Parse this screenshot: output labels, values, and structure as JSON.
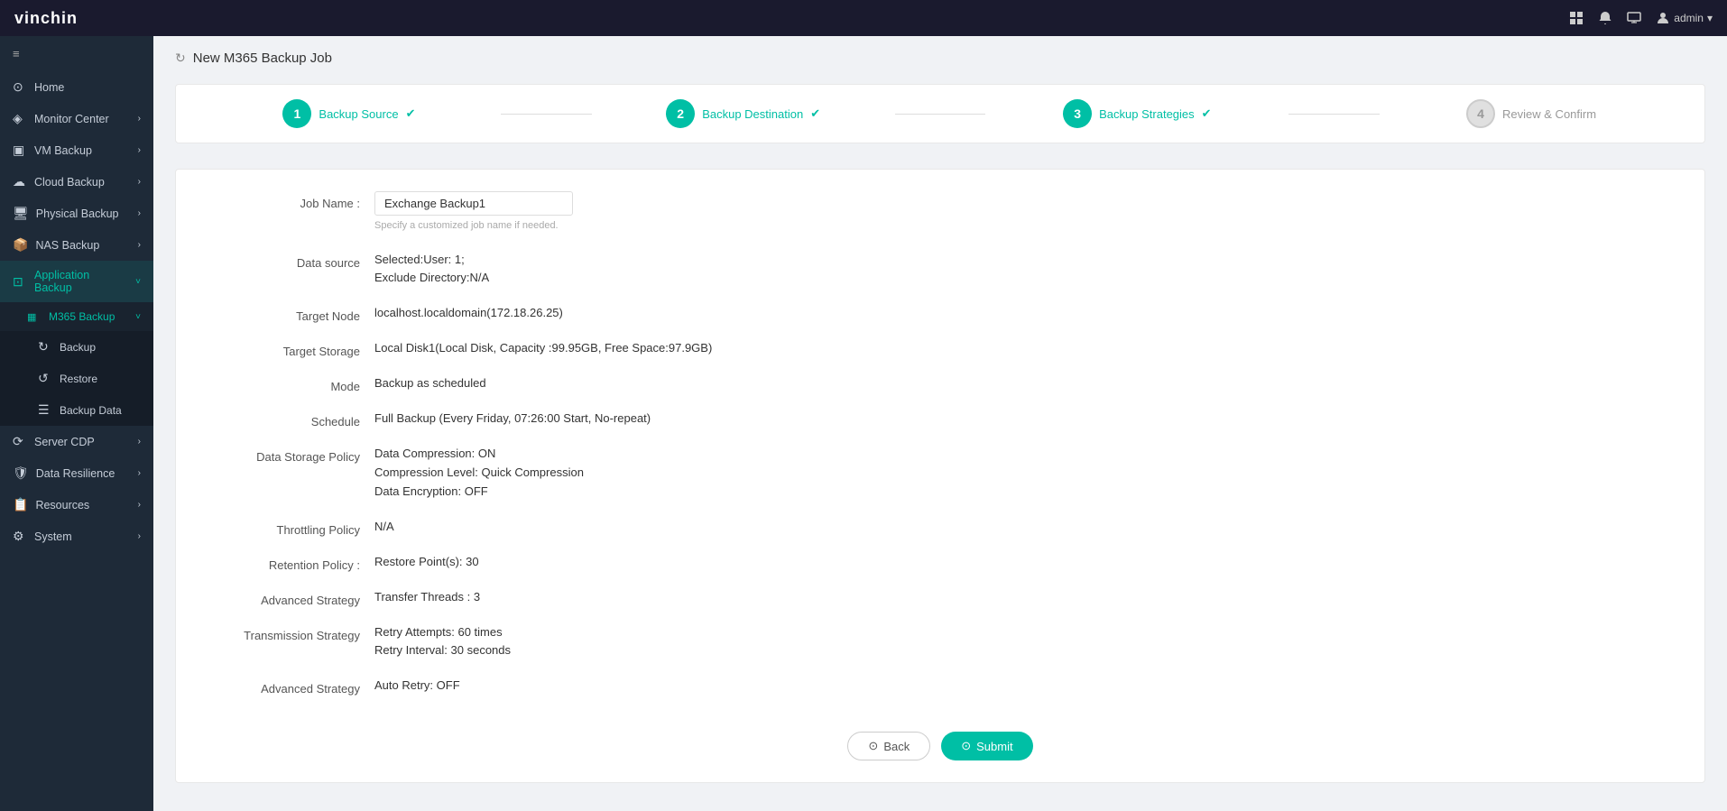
{
  "topbar": {
    "logo_vin": "vin",
    "logo_chin": "chin",
    "icons": [
      "grid-icon",
      "bell-icon",
      "monitor-icon",
      "user-icon"
    ],
    "user_label": "admin"
  },
  "sidebar": {
    "toggle_icon": "≡",
    "items": [
      {
        "id": "home",
        "label": "Home",
        "icon": "⊙",
        "expandable": false
      },
      {
        "id": "monitor-center",
        "label": "Monitor Center",
        "icon": "◈",
        "expandable": true
      },
      {
        "id": "vm-backup",
        "label": "VM Backup",
        "icon": "▣",
        "expandable": true
      },
      {
        "id": "cloud-backup",
        "label": "Cloud Backup",
        "icon": "☁",
        "expandable": true
      },
      {
        "id": "physical-backup",
        "label": "Physical Backup",
        "icon": "🖥",
        "expandable": true
      },
      {
        "id": "nas-backup",
        "label": "NAS Backup",
        "icon": "📦",
        "expandable": true
      },
      {
        "id": "application-backup",
        "label": "Application Backup",
        "icon": "⊡",
        "expandable": true,
        "active": true,
        "children": [
          {
            "id": "m365-backup",
            "label": "M365 Backup",
            "expandable": true,
            "active": true,
            "children": [
              {
                "id": "backup",
                "label": "Backup"
              },
              {
                "id": "restore",
                "label": "Restore"
              },
              {
                "id": "backup-data",
                "label": "Backup Data"
              }
            ]
          }
        ]
      },
      {
        "id": "server-cdp",
        "label": "Server CDP",
        "icon": "⟳",
        "expandable": true
      },
      {
        "id": "data-resilience",
        "label": "Data Resilience",
        "icon": "🛡",
        "expandable": true
      },
      {
        "id": "resources",
        "label": "Resources",
        "icon": "📋",
        "expandable": true
      },
      {
        "id": "system",
        "label": "System",
        "icon": "⚙",
        "expandable": true
      }
    ]
  },
  "page": {
    "refresh_icon": "↻",
    "title": "New M365 Backup Job",
    "steps": [
      {
        "number": "1",
        "label": "Backup Source",
        "status": "done"
      },
      {
        "number": "2",
        "label": "Backup Destination",
        "status": "done"
      },
      {
        "number": "3",
        "label": "Backup Strategies",
        "status": "done"
      },
      {
        "number": "4",
        "label": "Review & Confirm",
        "status": "inactive"
      }
    ],
    "form": {
      "job_name_label": "Job Name :",
      "job_name_value": "Exchange Backup1",
      "job_name_hint": "Specify a customized job name if needed.",
      "data_source_label": "Data source",
      "data_source_value": "Selected:User: 1;\nExclude Directory:N/A",
      "target_node_label": "Target Node",
      "target_node_value": "localhost.localdomain(172.18.26.25)",
      "target_storage_label": "Target Storage",
      "target_storage_value": "Local Disk1(Local Disk, Capacity :99.95GB, Free Space:97.9GB)",
      "mode_label": "Mode",
      "mode_value": "Backup as scheduled",
      "schedule_label": "Schedule",
      "schedule_value": "Full Backup (Every Friday, 07:26:00 Start, No-repeat)",
      "data_storage_policy_label": "Data Storage Policy",
      "data_storage_policy_line1": "Data Compression: ON",
      "data_storage_policy_line2": "Compression Level: Quick",
      "data_storage_policy_line3": "Compression",
      "data_storage_policy_line4": "Data Encryption: OFF",
      "throttling_policy_label": "Throttling Policy",
      "throttling_policy_value": "N/A",
      "retention_policy_label": "Retention Policy :",
      "retention_policy_value": "Restore Point(s): 30",
      "advanced_strategy_label": "Advanced Strategy",
      "advanced_strategy_value": "Transfer Threads : 3",
      "transmission_strategy_label": "Transmission Strategy",
      "transmission_strategy_line1": "Retry Attempts: 60 times",
      "transmission_strategy_line2": "Retry Interval: 30 seconds",
      "advanced_strategy2_label": "Advanced Strategy",
      "advanced_strategy2_value": "Auto Retry:  OFF"
    },
    "buttons": {
      "back_icon": "⊙",
      "back_label": "Back",
      "submit_icon": "⊙",
      "submit_label": "Submit"
    }
  },
  "colors": {
    "teal": "#00bfa5",
    "dark_bg": "#1e2a38",
    "inactive_step": "#e0e0e0"
  }
}
